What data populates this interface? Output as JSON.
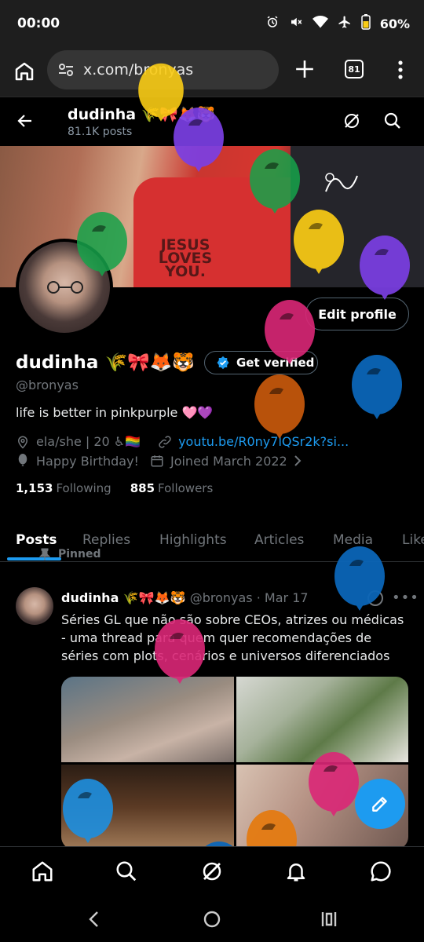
{
  "status_bar": {
    "time": "00:00",
    "battery": "60%",
    "icons": [
      "alarm-icon",
      "mute-icon",
      "wifi-icon",
      "airplane-icon",
      "battery-icon"
    ]
  },
  "browser": {
    "url": "x.com/bronyas",
    "tab_count": "81"
  },
  "header": {
    "name": "dudinha 🌾🎀🦊🐯",
    "post_count": "81.1K posts"
  },
  "profile": {
    "name": "dudinha 🌾🎀🦊🐯",
    "handle": "@bronyas",
    "bio": "life is better in pinkpurple 🩷💜",
    "pronouns": "ela/she | 20 ♿🏳️‍🌈",
    "link": "youtu.be/R0ny7lQSr2k?si...",
    "birthday": "Happy Birthday!",
    "joined": "Joined March 2022",
    "following_count": "1,153",
    "following_label": "Following",
    "followers_count": "885",
    "followers_label": "Followers",
    "edit_profile_label": "Edit profile",
    "get_verified_label": "Get verified"
  },
  "tabs": [
    "Posts",
    "Replies",
    "Highlights",
    "Articles",
    "Media",
    "Likes"
  ],
  "tab_visible": [
    "Posts",
    "Replies",
    "Highlights",
    "Articles",
    "Media",
    "Like"
  ],
  "active_tab": "Posts",
  "pinned_tweet": {
    "pinned_label": "Pinned",
    "author": "dudinha 🌾🎀🦊🐯",
    "handle": "@bronyas",
    "date": "Mar 17",
    "text": "Séries GL que não são sobre CEOs, atrizes ou médicas - uma thread para quem quer recomendações de séries com plots, cenários e universos diferenciados",
    "separator": "·"
  },
  "banner_text": "JESUS LOVES YOU.",
  "colors": {
    "accent": "#1d9bf0",
    "muted": "#71767b",
    "border": "#2f3336",
    "balloons": [
      "#7b3fe4",
      "#16a34a",
      "#facc15",
      "#db2777",
      "#0b66b8",
      "#c2570c"
    ]
  }
}
